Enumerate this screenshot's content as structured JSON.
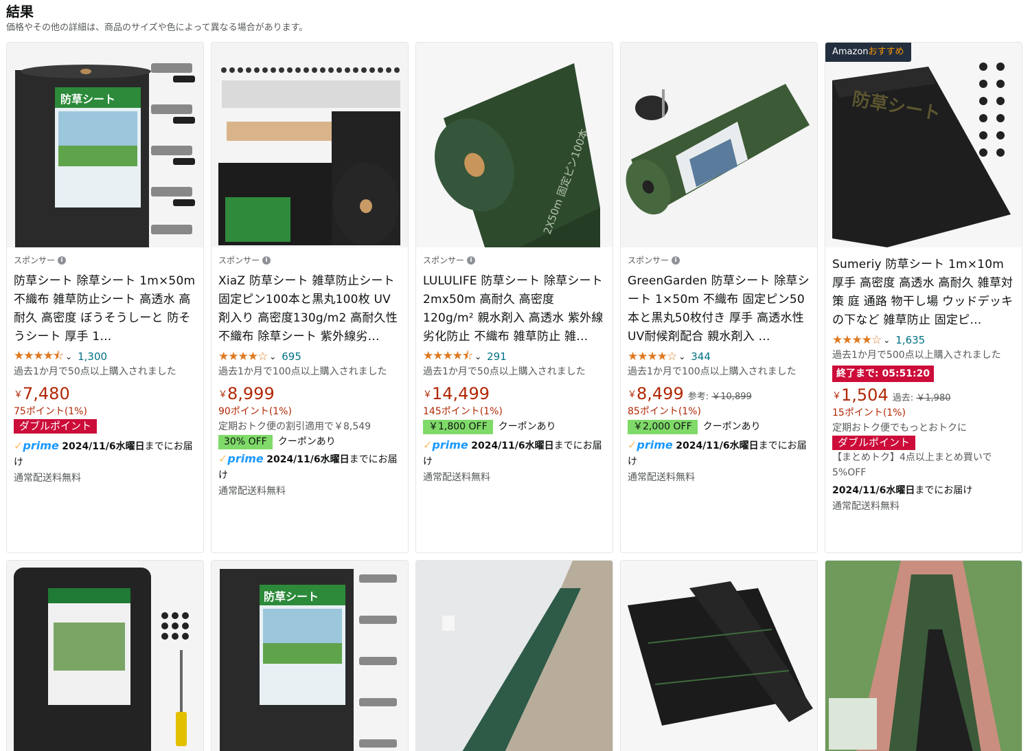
{
  "header": {
    "title": "結果",
    "subtitle": "価格やその他の詳細は、商品のサイズや色によって異なる場合があります。"
  },
  "common": {
    "sponsored": "スポンサー",
    "prime": "prime",
    "shipping_free": "通常配送料無料",
    "delivery_suffix": "までにお届け",
    "delivery_date": "2024/11/6水曜日",
    "coupon_text": "クーポンあり",
    "double_point": "ダブルポイント",
    "yen": "￥"
  },
  "products": [
    {
      "title": "防草シート 除草シート 1m×50m 不織布 雑草防止シート 高透水 高耐久 高密度 ぼうそうしーと 防そうシート 厚手 1…",
      "stars": "★★★★⯪",
      "rating_value": 4.5,
      "review_count": "1,300",
      "bought": "過去1か月で50点以上購入されました",
      "price": "7,480",
      "points": "75ポイント(1%)"
    },
    {
      "title": "XiaZ 防草シート 雑草防止シート 固定ピン100本と黒丸100枚 UV剤入り 高密度130g/m2 高耐久性不織布 除草シート 紫外線劣…",
      "stars": "★★★★☆",
      "rating_value": 4.0,
      "review_count": "695",
      "bought": "過去1か月で100点以上購入されました",
      "price": "8,999",
      "points": "90ポイント(1%)",
      "subscribe": "定期おトク便の割引適用で￥8,549",
      "coupon": "30% OFF"
    },
    {
      "title": "LULULIFE 防草シート 除草シート 2mx50m 高耐久 高密度 120g/m² 親水剤入 高透水 紫外線劣化防止 不織布 雑草防止 雑…",
      "stars": "★★★★⯪",
      "rating_value": 4.5,
      "review_count": "291",
      "bought": "過去1か月で50点以上購入されました",
      "price": "14,499",
      "points": "145ポイント(1%)",
      "coupon": "￥1,800 OFF"
    },
    {
      "title": "GreenGarden 防草シート 除草シート 1×50m 不織布 固定ピン50本と黒丸50枚付き 厚手 高透水性 UV耐候剤配合 親水剤入 …",
      "stars": "★★★★☆",
      "rating_value": 4.0,
      "review_count": "344",
      "bought": "過去1か月で100点以上購入されました",
      "price": "8,499",
      "ref_label": "参考:",
      "ref_price": "￥10,899",
      "points": "85ポイント(1%)",
      "coupon": "￥2,000 OFF"
    },
    {
      "badge_left": "Amazon",
      "badge_right": "おすすめ",
      "title": "Sumeriy 防草シート 1m×10m 厚手 高密度 高透水 高耐久 雑草対策 庭 通路 物干し場 ウッドデッキの下など 雑草防止 固定ピ…",
      "stars": "★★★★☆",
      "rating_value": 4.0,
      "review_count": "1,635",
      "bought": "過去1か月で500点以上購入されました",
      "deal": "終了まで: 05:51:20",
      "price": "1,504",
      "ref_label": "過去:",
      "ref_price": "￥1,980",
      "points": "15ポイント(1%)",
      "subscribe": "定期おトク便でもっとおトクに",
      "multi": "【まとめトク】4点以上まとめ買いで5%OFF"
    }
  ]
}
